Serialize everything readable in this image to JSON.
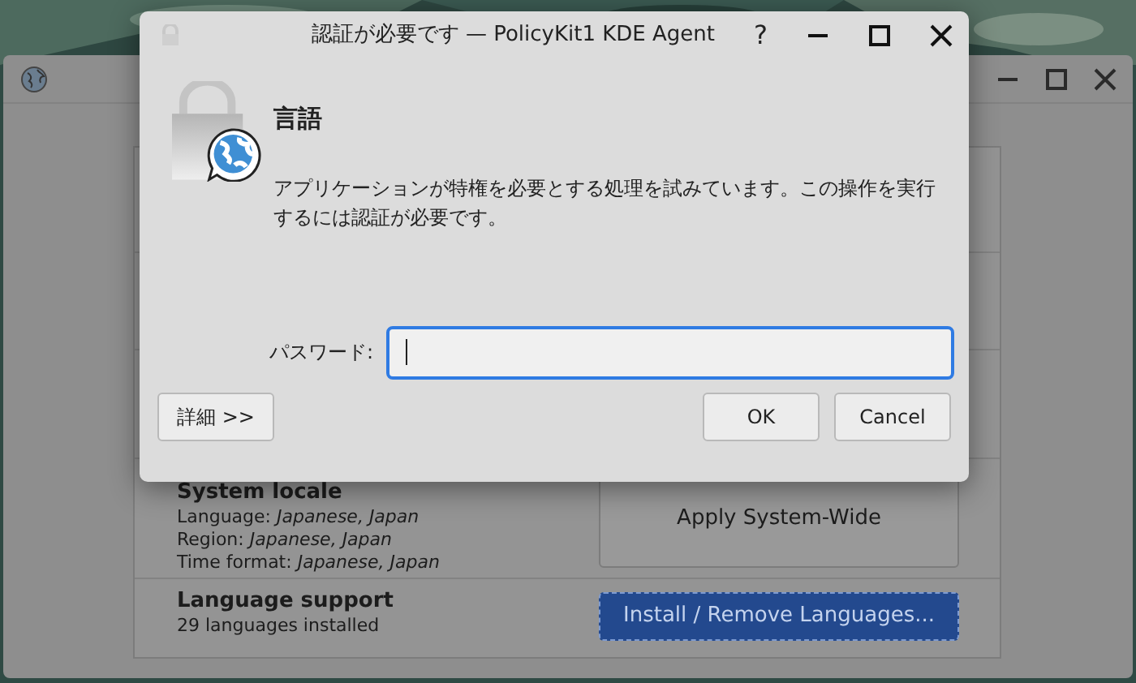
{
  "background_window": {
    "sections": [
      {
        "title": "System locale",
        "lines": [
          {
            "label": "Language:",
            "value": "Japanese, Japan"
          },
          {
            "label": "Region:",
            "value": "Japanese, Japan"
          },
          {
            "label": "Time format:",
            "value": "Japanese, Japan"
          }
        ],
        "button": {
          "label": "Apply System-Wide",
          "primary": false
        }
      },
      {
        "title": "Language support",
        "lines": [
          {
            "label": "29 languages installed"
          }
        ],
        "button": {
          "label": "Install / Remove Languages...",
          "primary": true
        }
      }
    ]
  },
  "dialog": {
    "title": "認証が必要です — PolicyKit1 KDE Agent",
    "help": "?",
    "heading": "言語",
    "message": "アプリケーションが特権を必要とする処理を試みています。この操作を実行するには認証が必要です。",
    "password": {
      "label": "パスワード:",
      "focused": true
    },
    "details_button": "詳細 >>",
    "buttons": [
      "OK",
      "Cancel"
    ]
  }
}
